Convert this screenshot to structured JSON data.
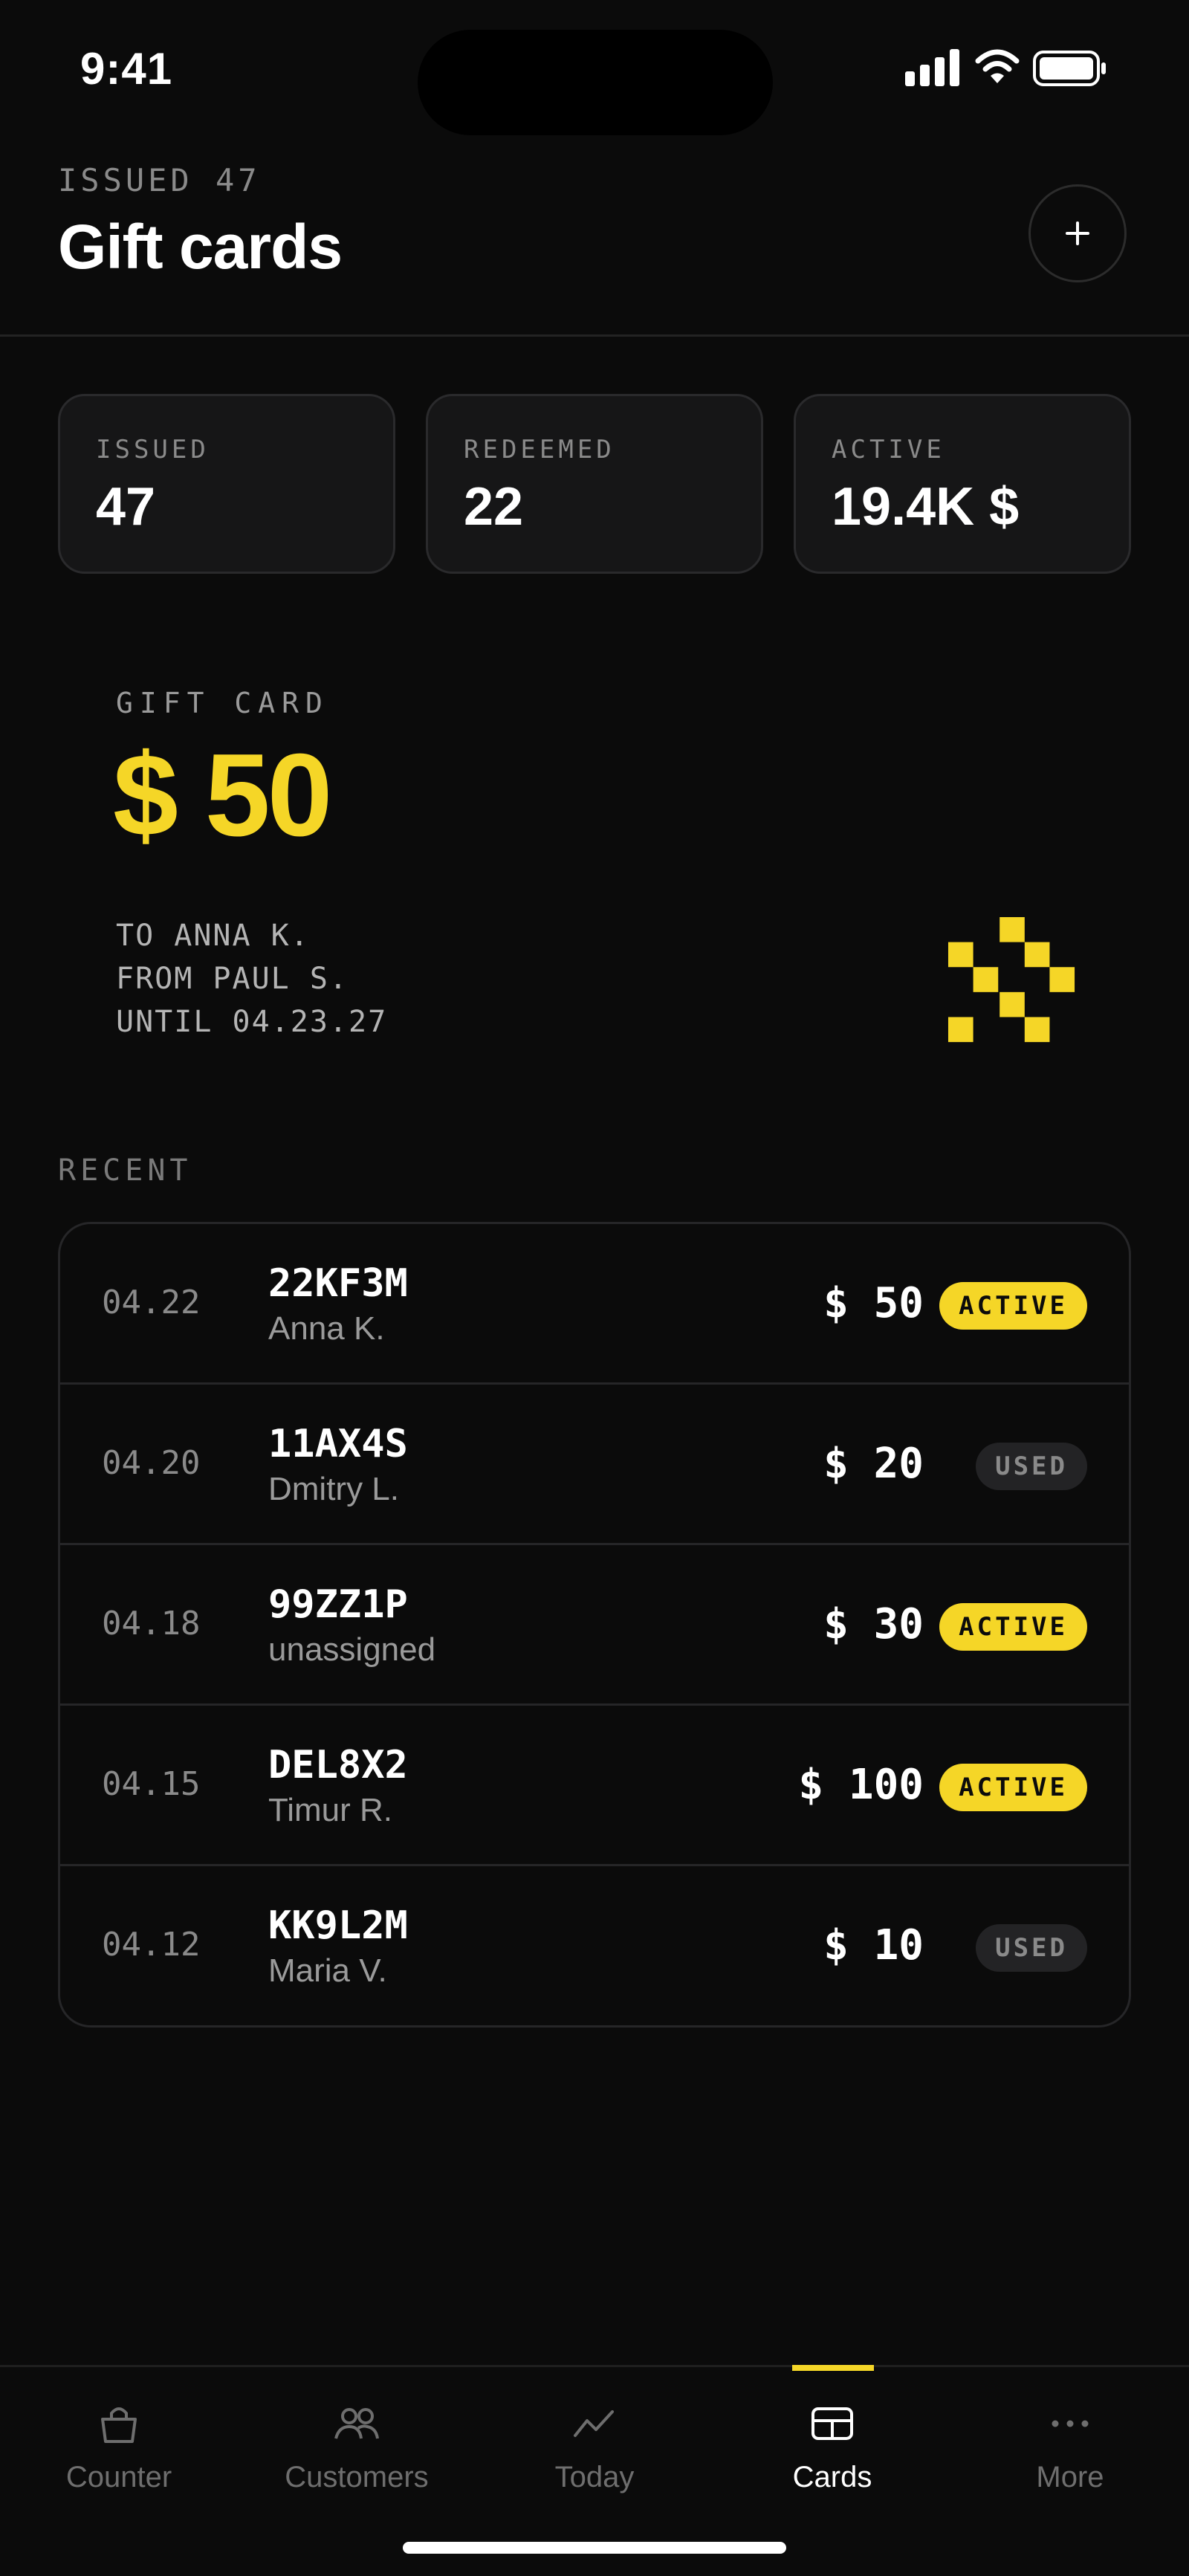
{
  "status_bar": {
    "time": "9:41"
  },
  "header": {
    "eyebrow": "ISSUED 47",
    "title": "Gift cards",
    "add_label": "+"
  },
  "stats": [
    {
      "label": "ISSUED",
      "value": "47"
    },
    {
      "label": "REDEEMED",
      "value": "22"
    },
    {
      "label": "ACTIVE",
      "value": "19.4K $"
    }
  ],
  "gift_card": {
    "eyebrow": "GIFT CARD",
    "amount": "$ 50",
    "to": "TO ANNA K.",
    "from": "FROM PAUL S.",
    "until": "UNTIL 04.23.27"
  },
  "recent": {
    "label": "RECENT",
    "rows": [
      {
        "date": "04.22",
        "code": "22KF3M",
        "name": "Anna K.",
        "amount": "$ 50",
        "status": "ACTIVE"
      },
      {
        "date": "04.20",
        "code": "11AX4S",
        "name": "Dmitry L.",
        "amount": "$ 20",
        "status": "USED"
      },
      {
        "date": "04.18",
        "code": "99ZZ1P",
        "name": "unassigned",
        "amount": "$ 30",
        "status": "ACTIVE"
      },
      {
        "date": "04.15",
        "code": "DEL8X2",
        "name": "Timur R.",
        "amount": "$ 100",
        "status": "ACTIVE"
      },
      {
        "date": "04.12",
        "code": "KK9L2M",
        "name": "Maria V.",
        "amount": "$ 10",
        "status": "USED"
      }
    ]
  },
  "tabs": [
    {
      "label": "Counter",
      "icon": "basket-icon"
    },
    {
      "label": "Customers",
      "icon": "users-icon"
    },
    {
      "label": "Today",
      "icon": "trend-icon"
    },
    {
      "label": "Cards",
      "icon": "card-icon",
      "active": true
    },
    {
      "label": "More",
      "icon": "more-icon"
    }
  ],
  "colors": {
    "accent": "#f5d627",
    "background": "#0b0b0b",
    "surface": "#161617",
    "muted": "#8a8a8a"
  }
}
